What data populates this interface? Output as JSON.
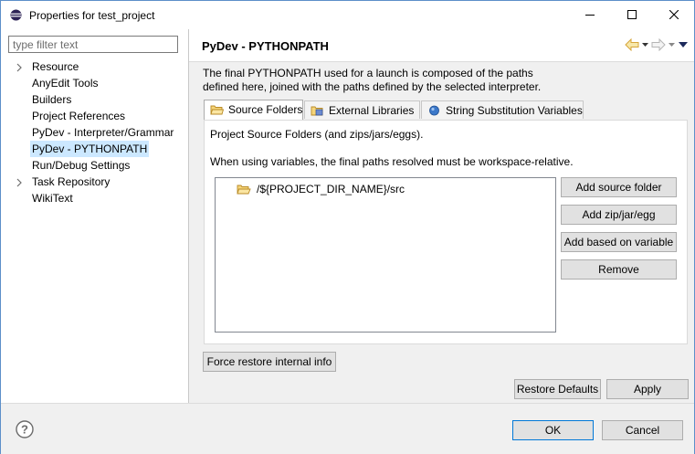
{
  "window": {
    "title": "Properties for test_project",
    "minimize_label": "minimize",
    "maximize_label": "maximize",
    "close_label": "close"
  },
  "filter": {
    "placeholder": "type filter text",
    "value": ""
  },
  "tree": {
    "items": [
      {
        "label": "Resource",
        "expandable": true
      },
      {
        "label": "AnyEdit Tools",
        "expandable": false
      },
      {
        "label": "Builders",
        "expandable": false
      },
      {
        "label": "Project References",
        "expandable": false
      },
      {
        "label": "PyDev - Interpreter/Grammar",
        "expandable": false
      },
      {
        "label": "PyDev - PYTHONPATH",
        "expandable": false,
        "selected": true
      },
      {
        "label": "Run/Debug Settings",
        "expandable": false
      },
      {
        "label": "Task Repository",
        "expandable": true
      },
      {
        "label": "WikiText",
        "expandable": false
      }
    ]
  },
  "page": {
    "title": "PyDev - PYTHONPATH",
    "description_line1": "The final PYTHONPATH used for a launch is composed of the paths",
    "description_line2": "defined here, joined with the paths defined by the selected interpreter.",
    "tabs": [
      {
        "label": "Source Folders",
        "icon": "folder-icon",
        "active": true
      },
      {
        "label": "External Libraries",
        "icon": "library-icon",
        "active": false
      },
      {
        "label": "String Substitution Variables",
        "icon": "variable-icon",
        "active": false
      }
    ],
    "source_folders_text": "Project Source Folders (and zips/jars/eggs).",
    "variables_note": "When using variables, the final paths resolved must be workspace-relative.",
    "folders": [
      "/${PROJECT_DIR_NAME}/src"
    ],
    "buttons": {
      "add_source_folder": "Add source folder",
      "add_zip": "Add zip/jar/egg",
      "add_variable": "Add based on variable",
      "remove": "Remove"
    },
    "force_restore": "Force restore internal info",
    "restore_defaults": "Restore Defaults",
    "apply": "Apply"
  },
  "footer": {
    "ok": "OK",
    "cancel": "Cancel"
  },
  "colors": {
    "selection": "#cce8ff",
    "default_button_border": "#0078d7",
    "window_border": "#5c8fc9"
  }
}
